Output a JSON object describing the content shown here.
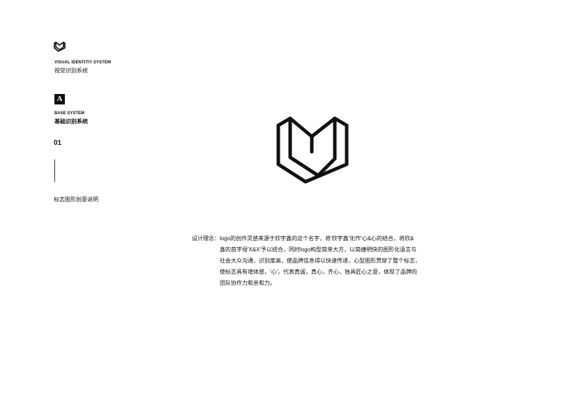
{
  "header": {
    "logo_icon": "heart-book-logo-icon",
    "system_en": "VISUAL IDENTITIY SYSTEM",
    "system_cn": "视觉识别系统"
  },
  "section": {
    "badge": "A",
    "name_en": "BASE SYSTEM",
    "name_cn": "基础识别系统",
    "page_number": "01",
    "title": "标志图形创意说明"
  },
  "description": {
    "label": "设计理念：",
    "lines": [
      "logo的创作灵感来源于欣宇鑫的这个名字，将'欣宇鑫'化作'心&心的结合，将欣&",
      "鑫的首字母'X&X'予以结合，同时logo构型简单大方，以简捷明快的图形化语言与",
      "社会大众沟通，识别度高，使品牌信息得以快速传递，心型图形贯穿了整个标志，",
      "使标志具有增体感，'心'，代表真诚，真心，齐心，独具匠心之意，体现了品牌的",
      "团队协作力和亲和力。"
    ]
  },
  "colors": {
    "ink": "#111111",
    "background": "#ffffff"
  }
}
